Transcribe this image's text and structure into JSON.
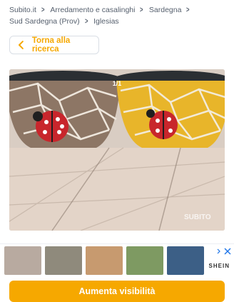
{
  "breadcrumb": {
    "items": [
      "Subito.it",
      "Arredamento e casalinghi",
      "Sardegna",
      "Sud Sardegna (Prov)",
      "Iglesias"
    ]
  },
  "back_button": {
    "label": "Torna alla ricerca",
    "icon": "chevron-left-icon"
  },
  "gallery": {
    "counter": "1/1",
    "watermark": "SUBITO"
  },
  "ad": {
    "brand": "SHEIN",
    "close_icon": "close-icon"
  },
  "cta": {
    "label": "Aumenta visibilità"
  },
  "colors": {
    "accent": "#f6a800",
    "text": "#555f6d",
    "border": "#d9dee5"
  }
}
